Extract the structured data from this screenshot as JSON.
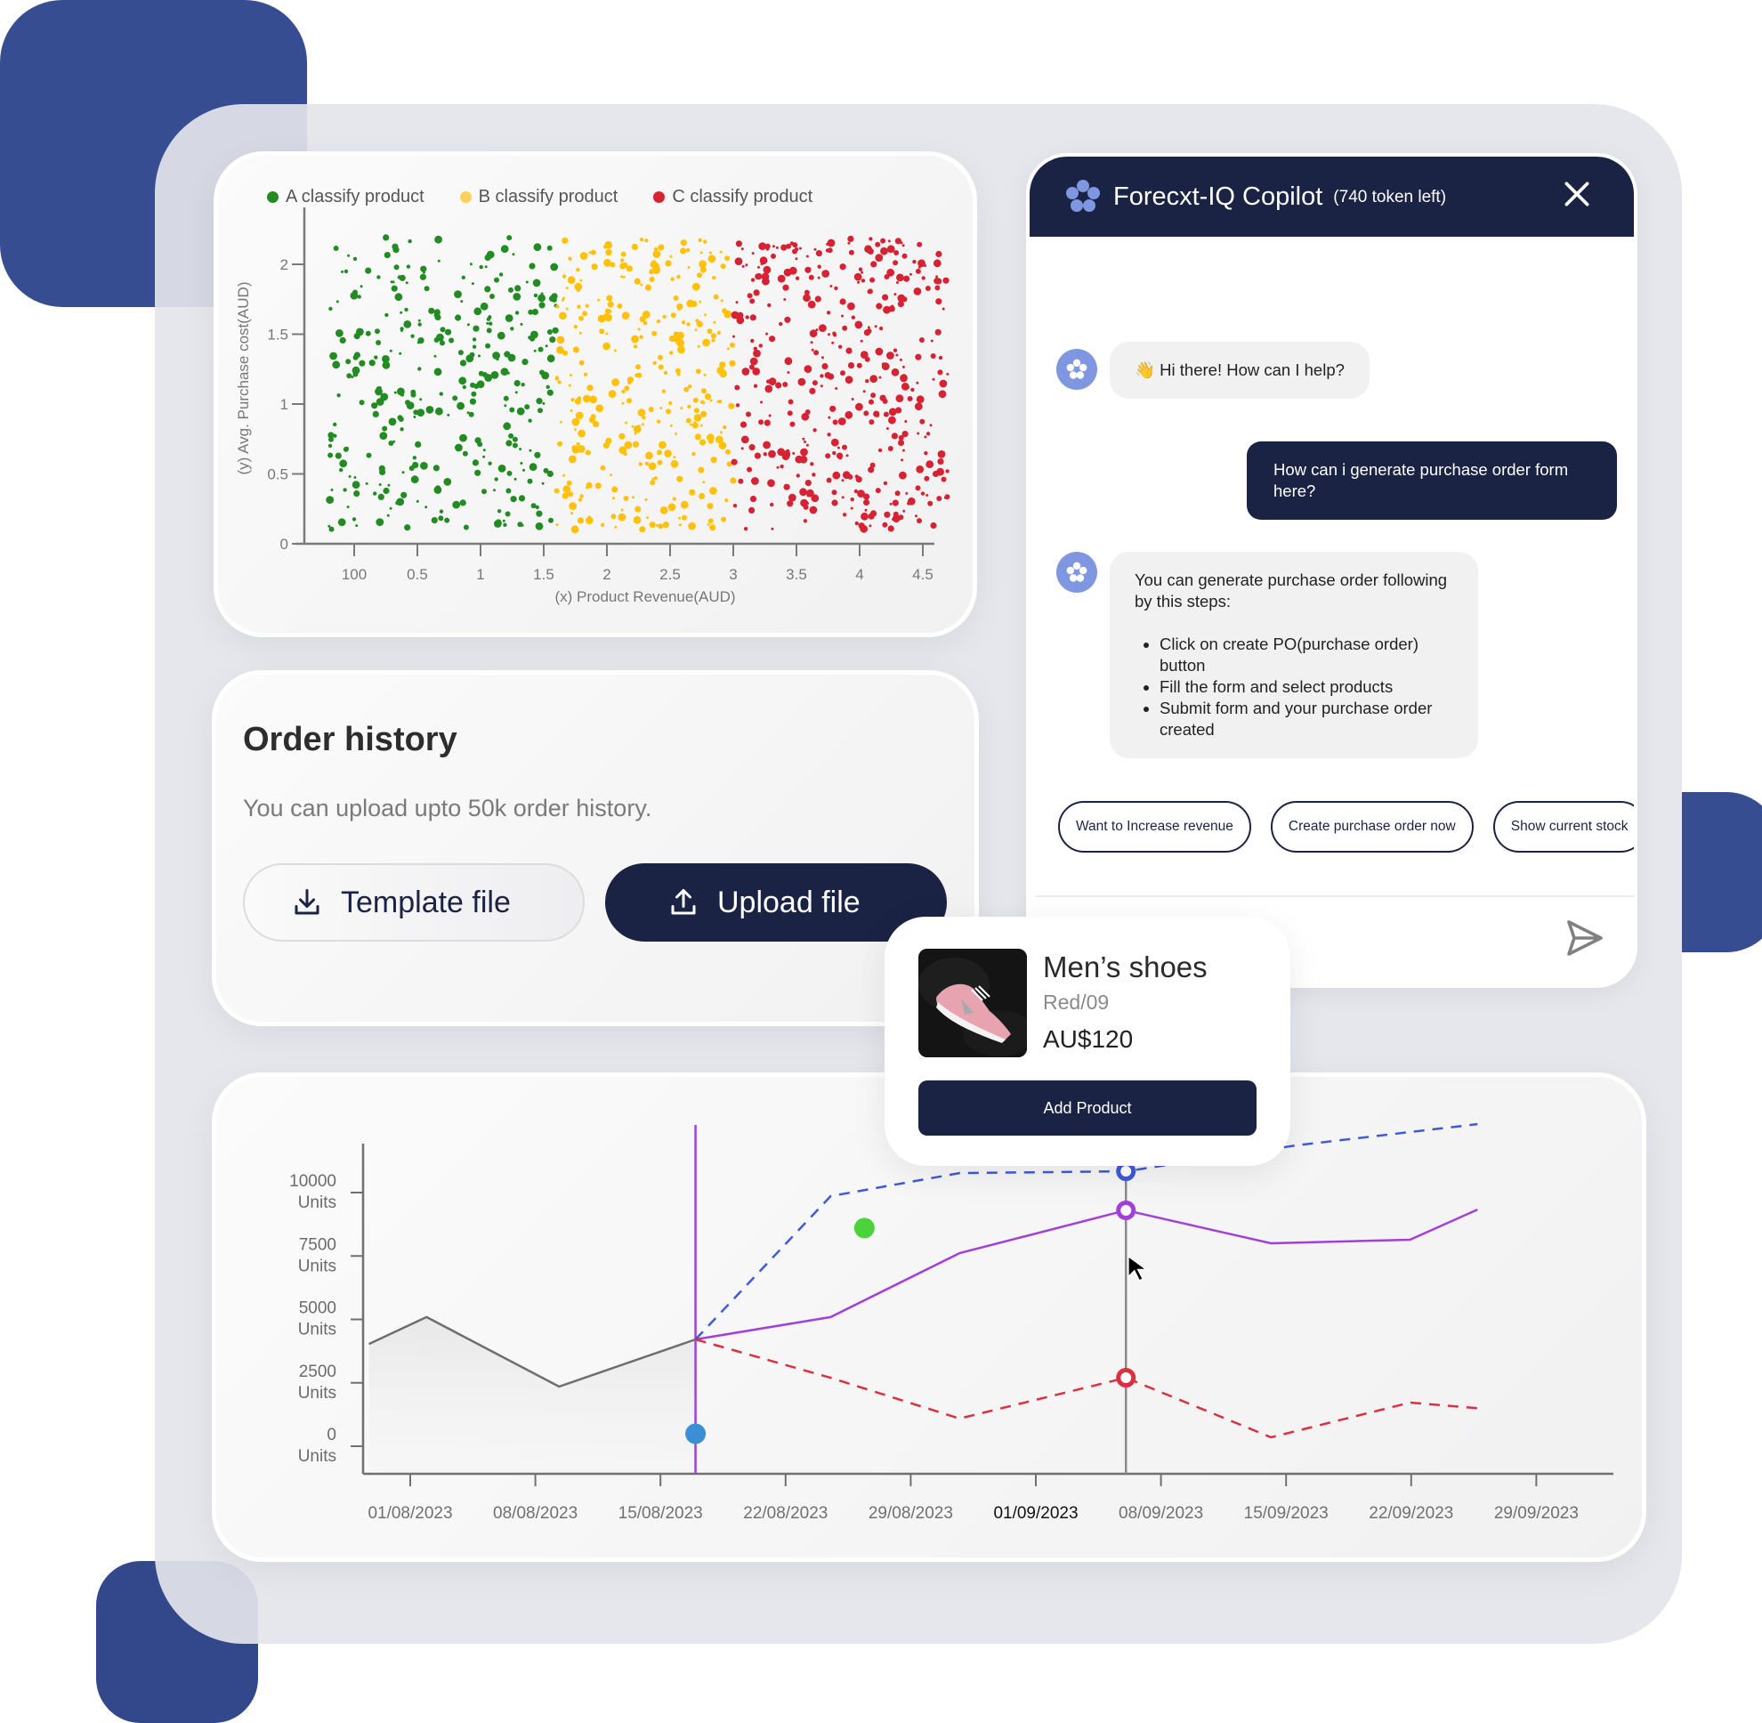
{
  "scatter": {
    "legend": [
      {
        "label": "A classify product",
        "color": "#228b22"
      },
      {
        "label": "B classify product",
        "color": "#ffc10a"
      },
      {
        "label": "C classify product",
        "color": "#d62333"
      }
    ]
  },
  "order_history": {
    "title": "Order history",
    "subtitle": "You can upload upto 50k order history.",
    "template_button": "Template file",
    "upload_button": "Upload file"
  },
  "chat": {
    "title": "Forecxt-IQ Copilot",
    "tokens": "(740 token left)",
    "messages": {
      "greeting": "👋 Hi there! How can I help?",
      "user_question": "How can i generate purchase order form here?",
      "answer_intro": "You can generate purchase order following by this steps:",
      "answer_steps": [
        "Click on create PO(purchase order) button",
        "Fill the form and select products",
        "Submit form and your purchase order created"
      ]
    },
    "suggestions": [
      "Want to Increase revenue",
      "Create purchase order now",
      "Show current stock"
    ],
    "input_placeholder": "...",
    "colors": {
      "header": "#1b2345",
      "avatar": "#7f97e0"
    }
  },
  "product_card": {
    "name": "Men’s shoes",
    "variant": "Red/09",
    "price": "AU$120",
    "button": "Add Product"
  },
  "chart_data": [
    {
      "type": "scatter",
      "title": "",
      "xlabel": "(x) Product Revenue(AUD)",
      "ylabel": "(y) Avg. Purchase cost(AUD)",
      "x_tick_labels": [
        "100",
        "0.5",
        "1",
        "1.5",
        "2",
        "2.5",
        "3",
        "3.5",
        "4",
        "4.5"
      ],
      "y_tick_labels": [
        "0",
        "0.5",
        "1",
        "1.5",
        "2"
      ],
      "ylim": [
        0,
        2.2
      ],
      "xlim": [
        -0.3,
        4.7
      ],
      "grid": false,
      "legend_position": "top-left",
      "series": [
        {
          "name": "A classify product",
          "color": "#228b22",
          "x_range": [
            -0.2,
            1.6
          ],
          "y_range": [
            0.1,
            2.2
          ],
          "approx_points": 330
        },
        {
          "name": "B classify product",
          "color": "#ffc10a",
          "x_range": [
            1.6,
            3.0
          ],
          "y_range": [
            0.1,
            2.2
          ],
          "approx_points": 330
        },
        {
          "name": "C classify product",
          "color": "#d62333",
          "x_range": [
            3.0,
            4.7
          ],
          "y_range": [
            0.1,
            2.2
          ],
          "approx_points": 400
        }
      ]
    },
    {
      "type": "line",
      "title": "",
      "x_tick_labels": [
        "01/08/2023",
        "08/08/2023",
        "15/08/2023",
        "22/08/2023",
        "29/08/2023",
        "01/09/2023",
        "08/09/2023",
        "15/09/2023",
        "22/09/2023",
        "29/09/2023"
      ],
      "highlight_tick": "01/09/2023",
      "y_tick_labels": [
        "0 Units",
        "2500 Units",
        "5000 Units",
        "7500 Units",
        "10000 Units"
      ],
      "ylim": [
        0,
        10000
      ],
      "x_units": "tick index (0 = 01/08/2023)",
      "series": [
        {
          "name": "history",
          "color": "#6e6e6e",
          "style": "solid",
          "area": true,
          "points": [
            [
              -0.33,
              4030
            ],
            [
              0.13,
              5090
            ],
            [
              1.19,
              2350
            ],
            [
              2.28,
              4210
            ]
          ]
        },
        {
          "name": "forecast",
          "color": "#a23fd8",
          "style": "solid",
          "points": [
            [
              2.28,
              4210
            ],
            [
              3.36,
              5090
            ],
            [
              4.39,
              7610
            ],
            [
              5.72,
              9300
            ],
            [
              6.88,
              8000
            ],
            [
              7.99,
              8140
            ],
            [
              8.53,
              9330
            ]
          ]
        },
        {
          "name": "upper-bound",
          "color": "#3e5ad8",
          "style": "dashed",
          "points": [
            [
              2.28,
              4210
            ],
            [
              3.36,
              9860
            ],
            [
              4.39,
              10770
            ],
            [
              5.72,
              10840
            ],
            [
              7.08,
              11860
            ],
            [
              8.53,
              12700
            ]
          ]
        },
        {
          "name": "lower-bound",
          "color": "#da3040",
          "style": "dashed",
          "points": [
            [
              2.28,
              4210
            ],
            [
              3.36,
              2700
            ],
            [
              4.39,
              1090
            ],
            [
              5.72,
              2700
            ],
            [
              6.88,
              350
            ],
            [
              7.99,
              1720
            ],
            [
              8.53,
              1500
            ]
          ]
        }
      ],
      "markers": [
        {
          "name": "green-event",
          "x": 3.63,
          "y": 8600,
          "color": "#4cd23a"
        },
        {
          "name": "blue-event",
          "x": 2.28,
          "y": 490,
          "color": "#3b8fd4"
        }
      ],
      "today_line_x": 2.28,
      "hover_line_x": 5.72,
      "hover_values": {
        "upper-bound": 10840,
        "forecast": 9300,
        "lower-bound": 2700
      }
    }
  ]
}
